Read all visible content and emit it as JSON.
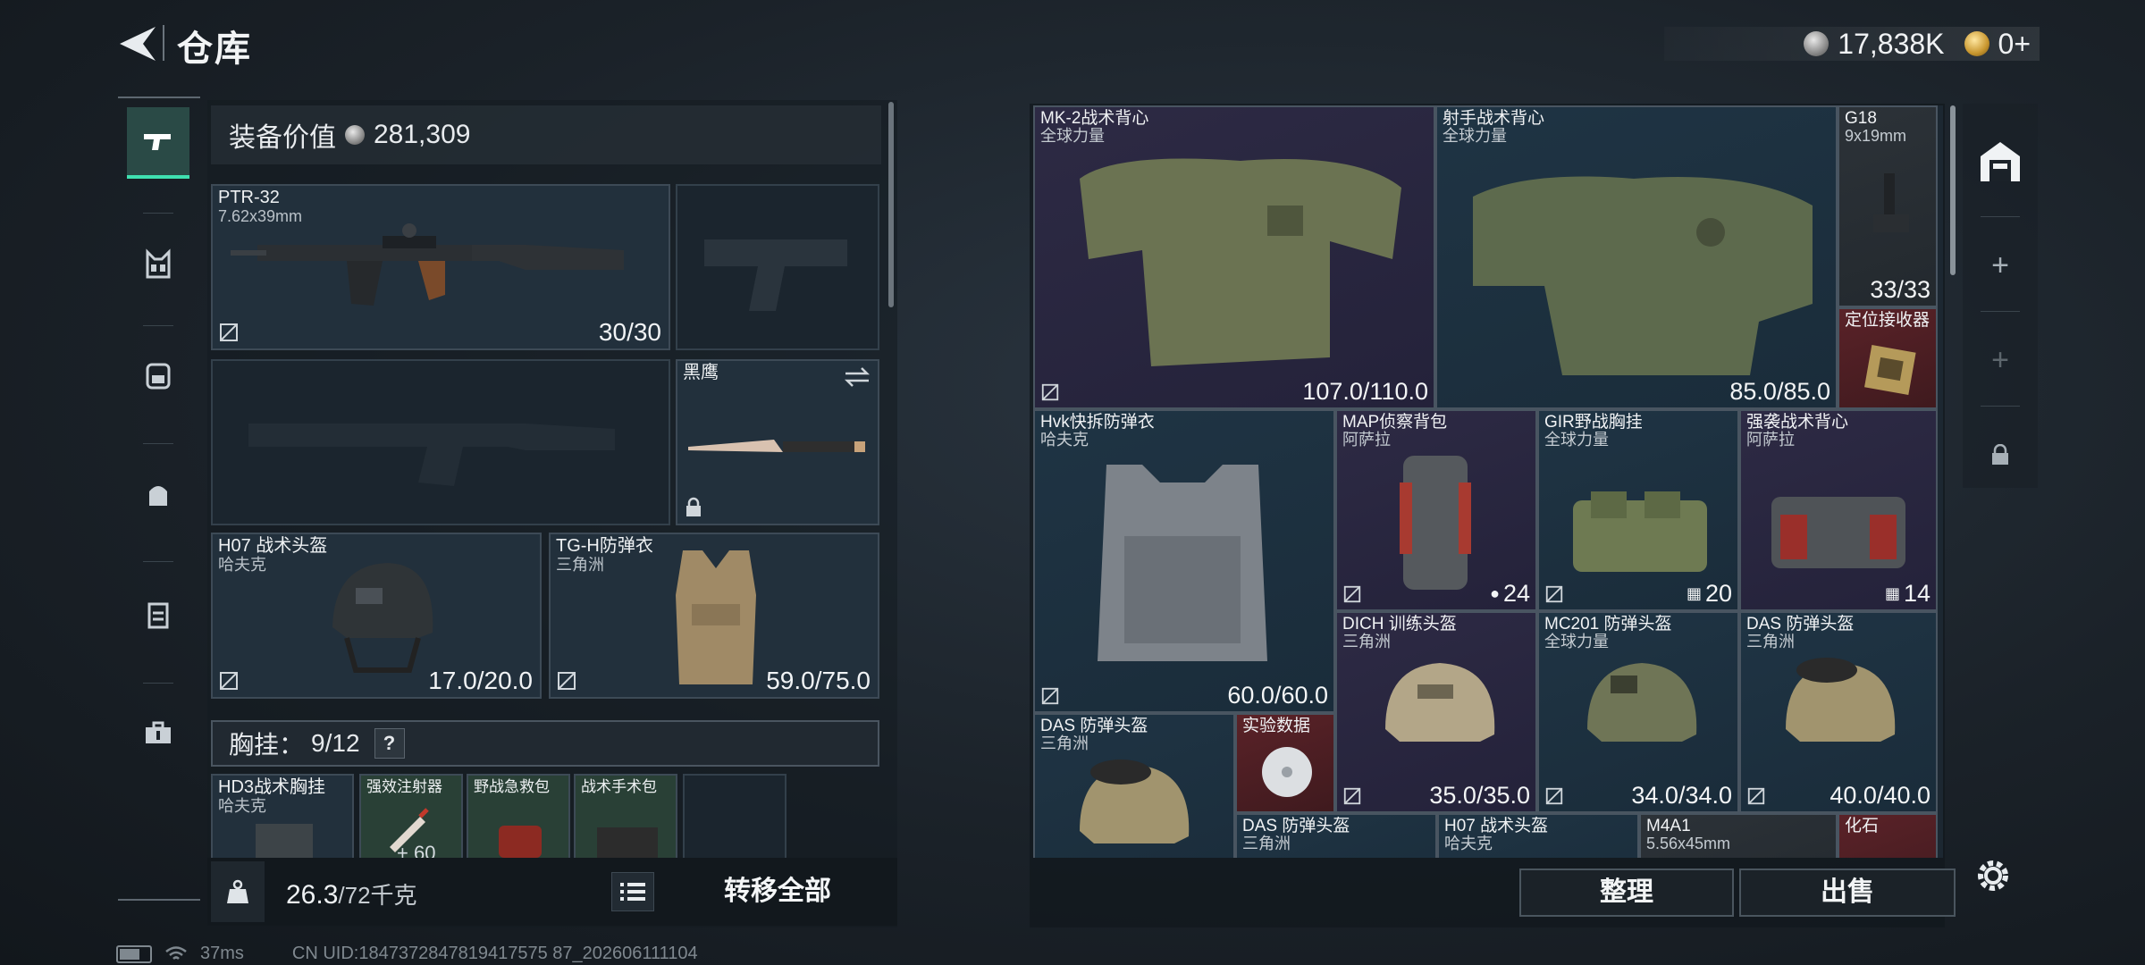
{
  "header": {
    "title": "仓库",
    "silver_amount": "17,838K",
    "gold_amount": "0+"
  },
  "loadout": {
    "value_label": "装备价值",
    "value": "281,309",
    "primary_weapon": {
      "name": "PTR-32",
      "caliber": "7.62x39mm",
      "ammo": "30/30"
    },
    "knife": {
      "name": "黑鹰"
    },
    "helmet": {
      "name": "H07 战术头盔",
      "brand": "哈夫克",
      "durability": "17.0/20.0"
    },
    "armor": {
      "name": "TG-H防弹衣",
      "brand": "三角洲",
      "durability": "59.0/75.0"
    },
    "chest_rig_label": "胸挂：",
    "chest_rig_capacity": "9/12",
    "help_mark": "?",
    "rig_items": [
      {
        "name": "HD3战术胸挂",
        "brand": "哈夫克"
      },
      {
        "name": "强效注射器",
        "count": "60"
      },
      {
        "name": "野战急救包"
      },
      {
        "name": "战术手术包"
      }
    ],
    "weight_value": "26.3",
    "weight_max": "/72千克",
    "transfer_all_label": "转移全部"
  },
  "status": {
    "ping": "37ms",
    "uid": "CN UID:1847372847819417575 87_202606111104"
  },
  "stash": {
    "items": [
      {
        "name": "MK-2战术背心",
        "brand": "全球力量",
        "value": "107.0/110.0"
      },
      {
        "name": "射手战术背心",
        "brand": "全球力量",
        "value": "85.0/85.0"
      },
      {
        "name": "G18",
        "brand": "9x19mm",
        "value": "33/33"
      },
      {
        "name": "定位接收器"
      },
      {
        "name": "Hvk快拆防弹衣",
        "brand": "哈夫克",
        "value": "60.0/60.0"
      },
      {
        "name": "MAP侦察背包",
        "brand": "阿萨拉",
        "value": "24"
      },
      {
        "name": "GIR野战胸挂",
        "brand": "全球力量",
        "value": "20"
      },
      {
        "name": "强袭战术背心",
        "brand": "阿萨拉",
        "value": "14"
      },
      {
        "name": "DICH 训练头盔",
        "brand": "三角洲",
        "value": "35.0/35.0"
      },
      {
        "name": "MC201 防弹头盔",
        "brand": "全球力量",
        "value": "34.0/34.0"
      },
      {
        "name": "DAS 防弹头盔",
        "brand": "三角洲",
        "value": "40.0/40.0"
      },
      {
        "name": "DAS 防弹头盔",
        "brand": "三角洲"
      },
      {
        "name": "实验数据"
      },
      {
        "name": "DAS 防弹头盔",
        "brand": "三角洲"
      },
      {
        "name": "H07 战术头盔",
        "brand": "哈夫克"
      },
      {
        "name": "M4A1",
        "brand": "5.56x45mm"
      },
      {
        "name": "化石"
      }
    ],
    "sort_label": "整理",
    "sell_label": "出售"
  },
  "colors": {
    "accent": "#3fe0b0",
    "rarity_purple": "#2d2a44",
    "rarity_blue": "#1f3444",
    "rarity_red": "#5a2228"
  }
}
